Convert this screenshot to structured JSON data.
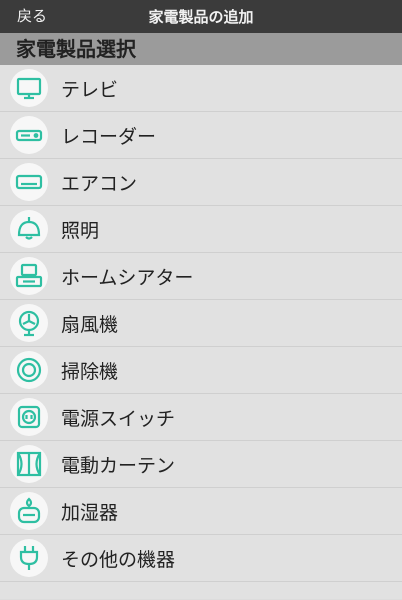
{
  "nav": {
    "back_label": "戻る",
    "title": "家電製品の追加"
  },
  "section_title": "家電製品選択",
  "accent_color": "#2ebfa2",
  "items": [
    {
      "label": "テレビ",
      "icon": "tv-icon"
    },
    {
      "label": "レコーダー",
      "icon": "recorder-icon"
    },
    {
      "label": "エアコン",
      "icon": "air-conditioner-icon"
    },
    {
      "label": "照明",
      "icon": "ceiling-light-icon"
    },
    {
      "label": "ホームシアター",
      "icon": "home-theater-icon"
    },
    {
      "label": "扇風機",
      "icon": "fan-icon"
    },
    {
      "label": "掃除機",
      "icon": "robot-vacuum-icon"
    },
    {
      "label": "電源スイッチ",
      "icon": "power-outlet-icon"
    },
    {
      "label": "電動カーテン",
      "icon": "curtain-icon"
    },
    {
      "label": "加湿器",
      "icon": "humidifier-icon"
    },
    {
      "label": "その他の機器",
      "icon": "plug-icon"
    }
  ]
}
